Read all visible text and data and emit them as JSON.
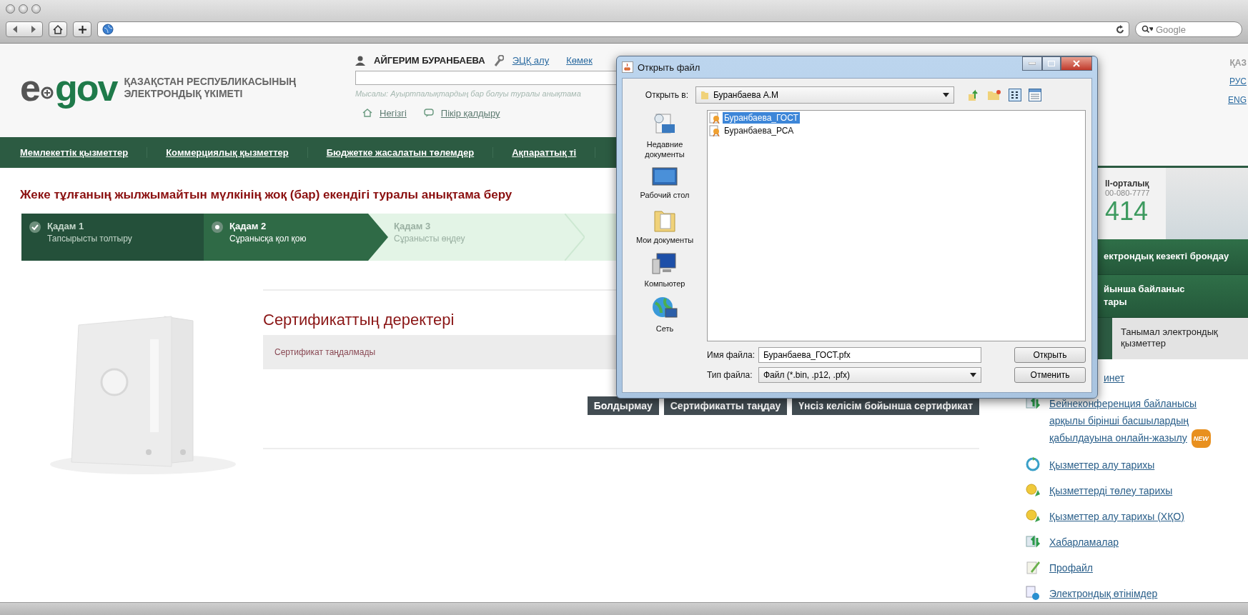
{
  "browser": {
    "search_placeholder": "Google"
  },
  "header": {
    "logo": [
      "e",
      "gov"
    ],
    "org_name": [
      "ҚАЗАҚСТАН РЕСПУБЛИКАСЫНЫҢ",
      "ЭЛЕКТРОНДЫҚ ҮКІМЕТІ"
    ],
    "user_name": "АЙГЕРИМ БУРАНБАЕВА",
    "user_links": [
      "ЭЦҚ алу",
      "Көмек"
    ],
    "search_hint": "Мысалы: Ауыртпалықтардың бар болуы туралы анықтама",
    "quick_links": [
      {
        "label": "Негізгі",
        "kind": "home"
      },
      {
        "label": "Пікір қалдыру",
        "kind": "comment"
      }
    ]
  },
  "languages": [
    {
      "label": "ҚАЗ",
      "selected": true
    },
    {
      "label": "РУС",
      "selected": false
    },
    {
      "label": "ENG",
      "selected": false
    }
  ],
  "nav": [
    "Мемлекеттік қызметтер",
    "Коммерциялық қызметтер",
    "Бюджетке жасалатын төлемдер",
    "Ақпараттық ті"
  ],
  "page_title": "Жеке тұлғаның жылжымайтын мүлкінің жоқ (бар) екендігі туралы анықтама беру",
  "steps": [
    {
      "title": "Қадам 1",
      "subtitle": "Тапсырысты толтыру",
      "done": true,
      "selected": false
    },
    {
      "title": "Қадам 2",
      "subtitle": "Сұранысқа қол қою",
      "done": false,
      "selected": true
    },
    {
      "title": "Қадам 3",
      "subtitle": "Сұранысты өңдеу",
      "done": false,
      "selected": false
    }
  ],
  "certificate": {
    "heading": "Сертификаттың деректері",
    "message": "Сертификат таңдалмады"
  },
  "buttons": [
    "Болдырмау",
    "Сертификатты таңдау",
    "Үнсіз келісім бойынша сертификат"
  ],
  "sidebar": {
    "call_center": {
      "title": "ll-орталық",
      "phone": "00-080-7777",
      "number": "414"
    },
    "green_links": [
      {
        "lines": [
          "ектрондық кезекті брондау"
        ]
      },
      {
        "lines": [
          "йынша байланыс",
          "тары"
        ]
      }
    ],
    "tab": "Танымал электрондық қызметтер",
    "services": [
      {
        "label": "инет",
        "kind": "none"
      },
      {
        "label": "Бейнеконференция байланысы арқылы бірінші басшылардың қабылдауына онлайн-жазылу",
        "kind": "arrows",
        "badge": "NEW"
      },
      {
        "label": "Қызметтер алу тарихы",
        "kind": "refresh"
      },
      {
        "label": "Қызметтерді төлеу тарихы",
        "kind": "coin"
      },
      {
        "label": "Қызметтер алу тарихы (ХҚО)",
        "kind": "coin"
      },
      {
        "label": "Хабарламалар",
        "kind": "arrows"
      },
      {
        "label": "Профайл",
        "kind": "pencil"
      },
      {
        "label": "Электрондық өтінімдер",
        "kind": "document"
      }
    ]
  },
  "dialog": {
    "title": "Открыть файл",
    "look_in_label": "Открыть в:",
    "look_in": "Буранбаева А.М",
    "places": [
      {
        "label": "Недавние документы",
        "kind": "recent"
      },
      {
        "label": "Рабочий стол",
        "kind": "desktop"
      },
      {
        "label": "Мои документы",
        "kind": "documents"
      },
      {
        "label": "Компьютер",
        "kind": "computer"
      },
      {
        "label": "Сеть",
        "kind": "network"
      }
    ],
    "files": [
      {
        "name": "Буранбаева_ГОСТ",
        "selected": true
      },
      {
        "name": "Буранбаева_РСА",
        "selected": false
      }
    ],
    "filename_label": "Имя файла:",
    "filename": "Буранбаева_ГОСТ.pfx",
    "filetype_label": "Тип файла:",
    "filetype": "Файл (*.bin, .p12, .pfx)",
    "buttons": [
      "Открыть",
      "Отменить"
    ]
  }
}
